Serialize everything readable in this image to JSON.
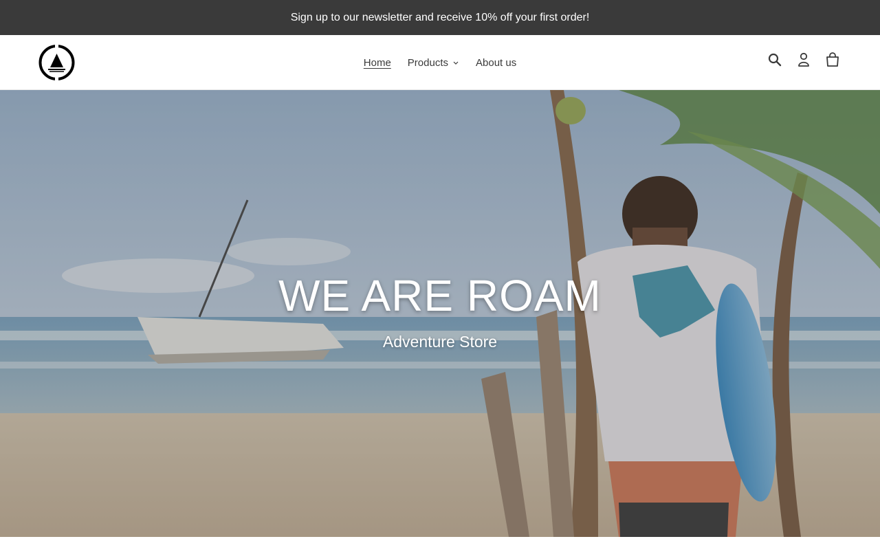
{
  "announcement": {
    "text": "Sign up to our newsletter and receive 10% off your first order!"
  },
  "header": {
    "logo_icon": "sailboat-circle-logo",
    "nav": [
      {
        "label": "Home",
        "active": true
      },
      {
        "label": "Products",
        "has_dropdown": true
      },
      {
        "label": "About us"
      }
    ],
    "icons": [
      "search-icon",
      "account-icon",
      "cart-icon"
    ]
  },
  "hero": {
    "title": "WE ARE ROAM",
    "subtitle": "Adventure Store"
  },
  "colors": {
    "announcement_bg": "#3a3a3a",
    "text": "#3a3a3a",
    "hero_text": "#ffffff"
  }
}
